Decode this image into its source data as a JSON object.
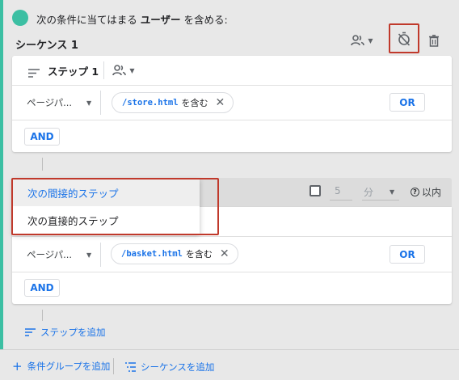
{
  "header": {
    "prefix": "次の条件に当てはまる",
    "bold": "ユーザー",
    "suffix": "を含める:"
  },
  "sequence": {
    "title": "シーケンス 1"
  },
  "step1": {
    "title": "ステップ 1",
    "dimension": "ページパ...",
    "chip_value": "/store.html",
    "chip_operator": "を含む",
    "or_label": "OR",
    "and_label": "AND"
  },
  "step2": {
    "time_value": "5",
    "time_unit": "分",
    "within_label": "以内",
    "dimension": "ページパ...",
    "chip_value": "/basket.html",
    "chip_operator": "を含む",
    "or_label": "OR",
    "and_label": "AND"
  },
  "step_menu": {
    "items": [
      "次の間接的ステップ",
      "次の直接的ステップ"
    ],
    "highlighted_index": 0
  },
  "add_step_label": "ステップを追加",
  "footer": {
    "add_condition_group": "条件グループを追加",
    "add_sequence": "シーケンスを追加"
  },
  "colors": {
    "accent": "#3cbfa3",
    "link": "#1a73e8",
    "highlight_box": "#c0392b"
  },
  "icons": [
    "user-scope-icon",
    "timer-off-icon",
    "trash-icon",
    "sort-lines-icon",
    "close-icon",
    "help-icon",
    "plus-icon",
    "list-icon"
  ]
}
